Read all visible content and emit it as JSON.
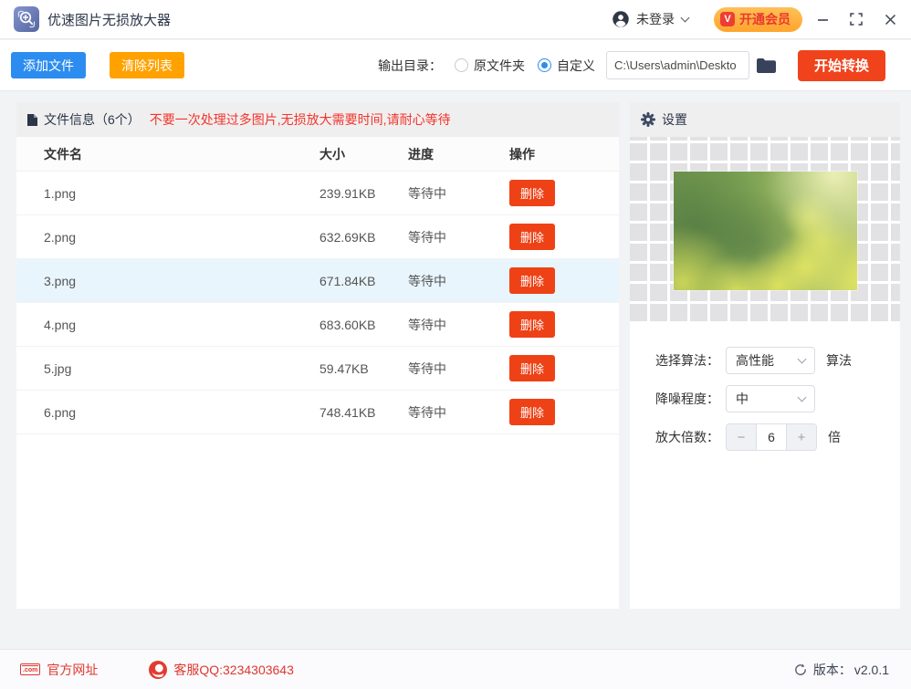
{
  "titlebar": {
    "app_title": "优速图片无损放大器",
    "login_status": "未登录",
    "vip_badge": "V",
    "vip_button": "开通会员"
  },
  "toolbar": {
    "add_files": "添加文件",
    "clear_list": "清除列表",
    "output_dir_label": "输出目录：",
    "radio_original": "原文件夹",
    "radio_custom": "自定义",
    "path_value": "C:\\Users\\admin\\Deskto",
    "start_button": "开始转换"
  },
  "file_panel": {
    "header": "文件信息（6个）",
    "warning": "不要一次处理过多图片,无损放大需要时间,请耐心等待",
    "columns": [
      "文件名",
      "大小",
      "进度",
      "操作"
    ],
    "delete_label": "删除",
    "rows": [
      {
        "name": "1.png",
        "size": "239.91KB",
        "status": "等待中",
        "highlighted": false
      },
      {
        "name": "2.png",
        "size": "632.69KB",
        "status": "等待中",
        "highlighted": false
      },
      {
        "name": "3.png",
        "size": "671.84KB",
        "status": "等待中",
        "highlighted": true
      },
      {
        "name": "4.png",
        "size": "683.60KB",
        "status": "等待中",
        "highlighted": false
      },
      {
        "name": "5.jpg",
        "size": "59.47KB",
        "status": "等待中",
        "highlighted": false
      },
      {
        "name": "6.png",
        "size": "748.41KB",
        "status": "等待中",
        "highlighted": false
      }
    ]
  },
  "settings_panel": {
    "header": "设置",
    "algorithm_label": "选择算法：",
    "algorithm_value": "高性能",
    "algorithm_suffix": "算法",
    "denoise_label": "降噪程度：",
    "denoise_value": "中",
    "scale_label": "放大倍数：",
    "scale_minus": "−",
    "scale_value": "6",
    "scale_plus": "+",
    "scale_suffix": "倍"
  },
  "footer": {
    "com_icon_text": ".com",
    "website": "官方网址",
    "qq": "客服QQ:3234303643",
    "version_label": "版本：",
    "version_value": "v2.0.1"
  },
  "colors": {
    "accent_blue": "#2d8cf0",
    "accent_orange": "#ffa200",
    "accent_red_orange": "#f0431c",
    "delete_red": "#ee4216",
    "warning_red": "#f5342c",
    "vip_pill": "#ffb143",
    "footer_red": "#e0372e",
    "selected_row": "#e9f5fd"
  }
}
